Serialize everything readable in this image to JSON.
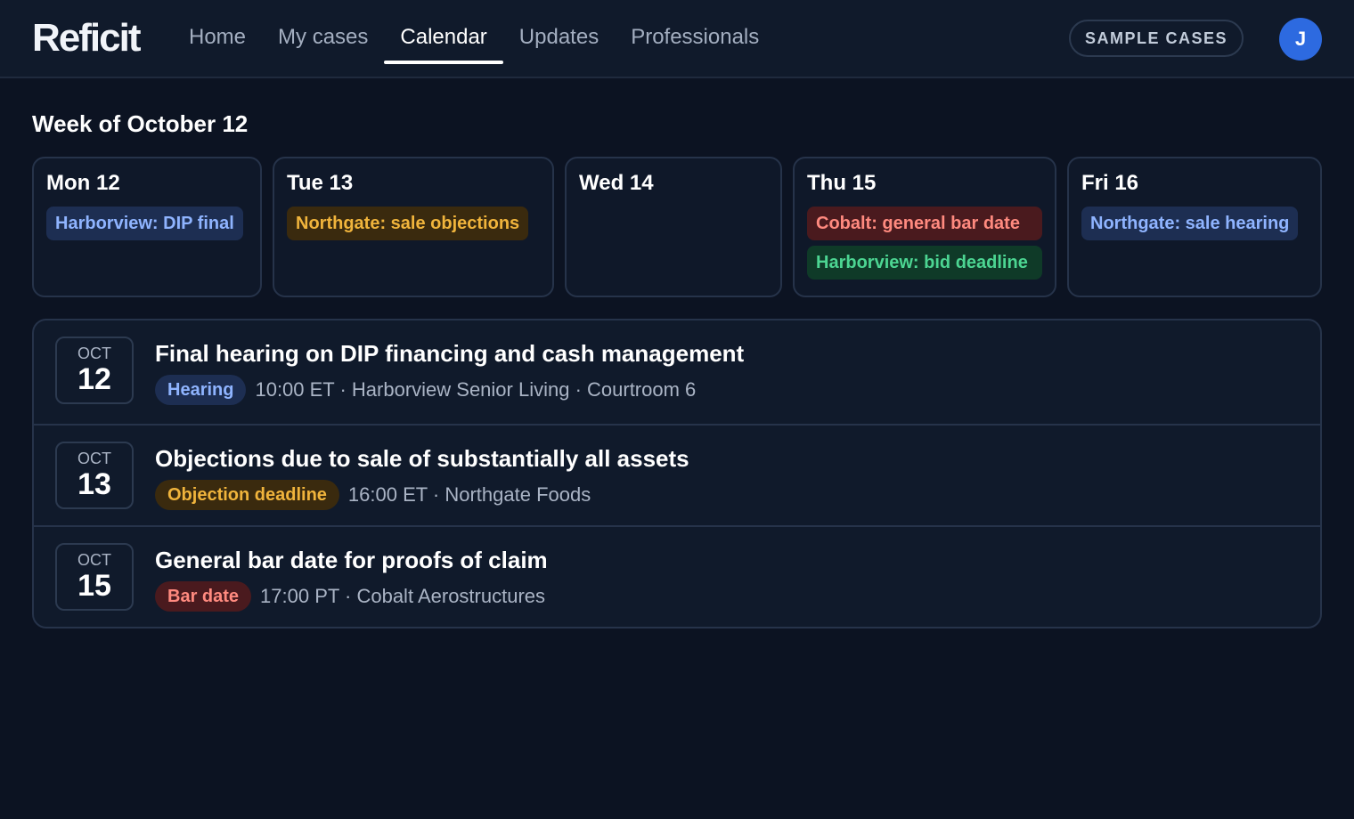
{
  "header": {
    "logo": "Reficit",
    "nav": [
      "Home",
      "My cases",
      "Calendar",
      "Updates",
      "Professionals"
    ],
    "active_nav": "Calendar",
    "sample_button": "SAMPLE CASES",
    "avatar_initial": "J"
  },
  "week": {
    "title": "Week of October 12",
    "days": [
      {
        "label": "Mon 12",
        "chips": [
          {
            "text": "Harborview: DIP final",
            "color": "blue"
          }
        ]
      },
      {
        "label": "Tue 13",
        "chips": [
          {
            "text": "Northgate: sale objections",
            "color": "amber"
          }
        ]
      },
      {
        "label": "Wed 14",
        "chips": []
      },
      {
        "label": "Thu 15",
        "chips": [
          {
            "text": "Cobalt: general bar date",
            "color": "red"
          },
          {
            "text": "Harborview: bid deadline",
            "color": "green"
          }
        ]
      },
      {
        "label": "Fri 16",
        "chips": [
          {
            "text": "Northgate: sale hearing",
            "color": "blue"
          }
        ]
      }
    ]
  },
  "events": [
    {
      "month": "OCT",
      "day": "12",
      "title": "Final hearing on DIP financing and cash management",
      "badge": "Hearing",
      "badge_color": "blue",
      "meta": "10:00 ET · Harborview Senior Living · Courtroom 6"
    },
    {
      "month": "OCT",
      "day": "13",
      "title": "Objections due to sale of substantially all assets",
      "badge": "Objection deadline",
      "badge_color": "amber",
      "meta": "16:00 ET · Northgate Foods"
    },
    {
      "month": "OCT",
      "day": "15",
      "title": "General bar date for proofs of claim",
      "badge": "Bar date",
      "badge_color": "red",
      "meta": "17:00 PT · Cobalt Aerostructures"
    }
  ],
  "colors": {
    "background": "#0c1322",
    "accent_blue": "#2d6ae0",
    "blue_text": "#8fb4ff",
    "amber_text": "#f0b43c",
    "red_text": "#ff8a7f",
    "green_text": "#4cd592"
  }
}
